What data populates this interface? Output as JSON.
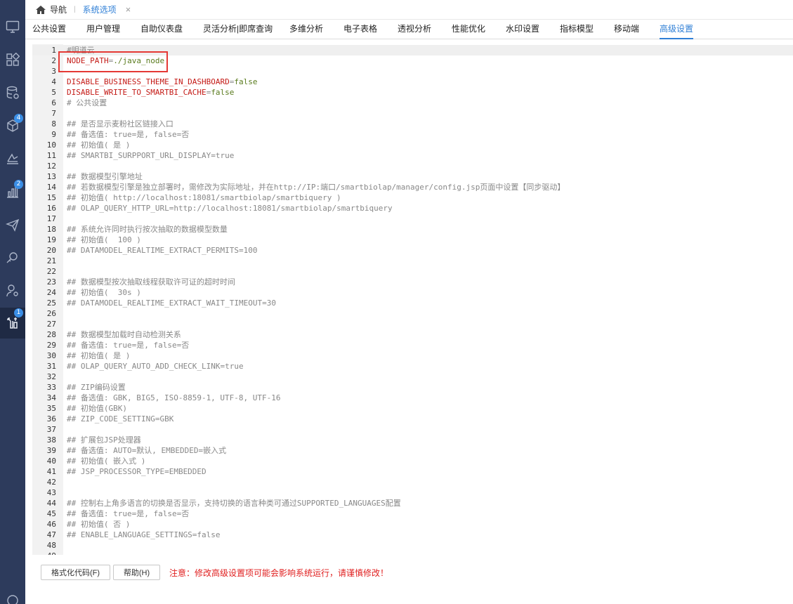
{
  "sidebar": {
    "icons": [
      {
        "name": "monitor-icon"
      },
      {
        "name": "dashboard-grid-icon"
      },
      {
        "name": "database-icon"
      },
      {
        "name": "cube-icon",
        "badge": "4"
      },
      {
        "name": "analysis-ramp-icon"
      },
      {
        "name": "bar-chart-icon",
        "badge": "2"
      },
      {
        "name": "send-icon"
      },
      {
        "name": "mining-icon"
      },
      {
        "name": "user-settings-icon"
      },
      {
        "name": "tools-icon",
        "badge": "1",
        "active": true
      },
      {
        "name": "profile-icon"
      }
    ]
  },
  "topbar": {
    "home_label": "导航",
    "separator": "|",
    "active_tab": "系统选项",
    "close": "×"
  },
  "settings_tabs": [
    "公共设置",
    "用户管理",
    "自助仪表盘",
    "灵活分析|即席查询",
    "多维分析",
    "电子表格",
    "透视分析",
    "性能优化",
    "水印设置",
    "指标模型",
    "移动端",
    "高级设置"
  ],
  "active_settings_tab": 11,
  "editor": {
    "lines": [
      [
        {
          "t": "#明道云"
        }
      ],
      [
        {
          "t": "NODE_PATH",
          "c": "key"
        },
        {
          "t": "="
        },
        {
          "t": "./java_node",
          "c": "val"
        }
      ],
      [],
      [
        {
          "t": "DISABLE_BUSINESS_THEME_IN_DASHBOARD",
          "c": "key"
        },
        {
          "t": "="
        },
        {
          "t": "false",
          "c": "val"
        }
      ],
      [
        {
          "t": "DISABLE_WRITE_TO_SMARTBI_CACHE",
          "c": "key"
        },
        {
          "t": "="
        },
        {
          "t": "false",
          "c": "val"
        }
      ],
      [
        {
          "t": "# 公共设置"
        }
      ],
      [],
      [
        {
          "t": "## 是否显示麦粉社区链接入口"
        }
      ],
      [
        {
          "t": "## 备选值: true=是, false=否"
        }
      ],
      [
        {
          "t": "## 初始值( 是 )"
        }
      ],
      [
        {
          "t": "## SMARTBI_SURPPORT_URL_DISPLAY=true"
        }
      ],
      [],
      [
        {
          "t": "## 数据模型引擎地址"
        }
      ],
      [
        {
          "t": "## 若数据模型引擎是独立部署时，需修改为实际地址，并在http://IP:端口/smartbiolap/manager/config.jsp页面中设置【同步驱动】"
        }
      ],
      [
        {
          "t": "## 初始值( http://localhost:18081/smartbiolap/smartbiquery )"
        }
      ],
      [
        {
          "t": "## OLAP_QUERY_HTTP_URL=http://localhost:18081/smartbiolap/smartbiquery"
        }
      ],
      [],
      [
        {
          "t": "## 系统允许同时执行按次抽取的数据模型数量"
        }
      ],
      [
        {
          "t": "## 初始值(  100 )"
        }
      ],
      [
        {
          "t": "## DATAMODEL_REALTIME_EXTRACT_PERMITS=100"
        }
      ],
      [],
      [],
      [
        {
          "t": "## 数据模型按次抽取线程获取许可证的超时时间"
        }
      ],
      [
        {
          "t": "## 初始值(  30s )"
        }
      ],
      [
        {
          "t": "## DATAMODEL_REALTIME_EXTRACT_WAIT_TIMEOUT=30"
        }
      ],
      [],
      [],
      [
        {
          "t": "## 数据模型加载时自动检测关系"
        }
      ],
      [
        {
          "t": "## 备选值: true=是, false=否"
        }
      ],
      [
        {
          "t": "## 初始值( 是 )"
        }
      ],
      [
        {
          "t": "## OLAP_QUERY_AUTO_ADD_CHECK_LINK=true"
        }
      ],
      [],
      [
        {
          "t": "## ZIP编码设置"
        }
      ],
      [
        {
          "t": "## 备选值: GBK, BIG5, ISO-8859-1, UTF-8, UTF-16"
        }
      ],
      [
        {
          "t": "## 初始值(GBK)"
        }
      ],
      [
        {
          "t": "## ZIP_CODE_SETTING=GBK"
        }
      ],
      [],
      [
        {
          "t": "## 扩展包JSP处理器"
        }
      ],
      [
        {
          "t": "## 备选值: AUTO=默认, EMBEDDED=嵌入式"
        }
      ],
      [
        {
          "t": "## 初始值( 嵌入式 )"
        }
      ],
      [
        {
          "t": "## JSP_PROCESSOR_TYPE=EMBEDDED"
        }
      ],
      [],
      [],
      [
        {
          "t": "## 控制右上角多语言的切换是否显示，支持切换的语言种类可通过SUPPORTED_LANGUAGES配置"
        }
      ],
      [
        {
          "t": "## 备选值: true=是, false=否"
        }
      ],
      [
        {
          "t": "## 初始值( 否 )"
        }
      ],
      [
        {
          "t": "## ENABLE_LANGUAGE_SETTINGS=false"
        }
      ],
      [],
      []
    ]
  },
  "buttons": {
    "format": "格式化代码(F)",
    "help": "帮助(H)"
  },
  "warning": "注意：修改高级设置项可能会影响系统运行，请谨慎修改！",
  "colors": {
    "sidebar_bg": "#2d3b5c",
    "accent": "#2f7fd6",
    "warning": "#e02020",
    "key": "#c41a16",
    "value": "#5a7b1e"
  }
}
